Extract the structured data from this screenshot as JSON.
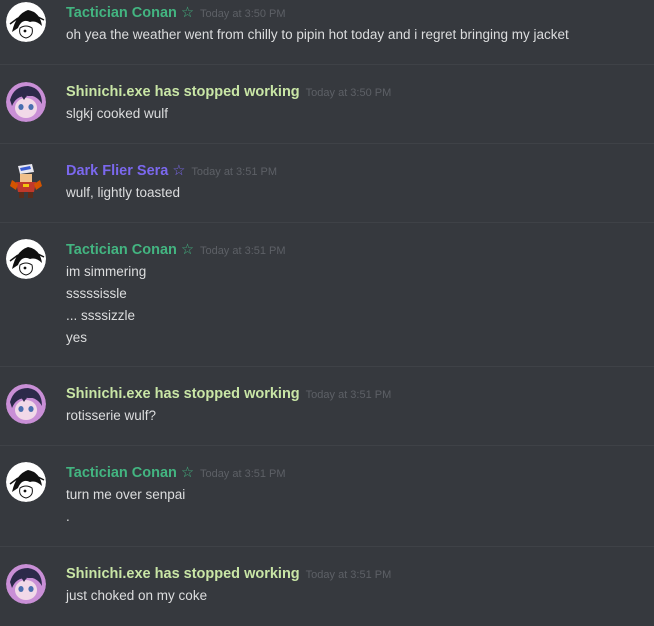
{
  "colors": {
    "background": "#36393e",
    "divider": "#3f4247",
    "message_text": "#dcddde",
    "timestamp": "#5d6066",
    "user_green": "#43b581",
    "user_lime": "#c9e6a6",
    "user_purple": "#7b68ee"
  },
  "messages": [
    {
      "author": "Tactician Conan ☆",
      "author_color": "green",
      "avatar": "conan-avatar",
      "timestamp": "Today at 3:50 PM",
      "lines": [
        "oh yea the weather went from chilly to pipin hot today and i regret bringing my jacket"
      ]
    },
    {
      "author": "Shinichi.exe has stopped working",
      "author_color": "lime",
      "avatar": "shinichi-avatar",
      "timestamp": "Today at 3:50 PM",
      "lines": [
        "slgkj cooked wulf"
      ]
    },
    {
      "author": "Dark Flier Sera ☆",
      "author_color": "purple",
      "avatar": "sera-avatar",
      "timestamp": "Today at 3:51 PM",
      "lines": [
        "wulf, lightly toasted"
      ]
    },
    {
      "author": "Tactician Conan ☆",
      "author_color": "green",
      "avatar": "conan-avatar",
      "timestamp": "Today at 3:51 PM",
      "lines": [
        "im simmering",
        "sssssissle",
        "... ssssizzle",
        "yes"
      ]
    },
    {
      "author": "Shinichi.exe has stopped working",
      "author_color": "lime",
      "avatar": "shinichi-avatar",
      "timestamp": "Today at 3:51 PM",
      "lines": [
        "rotisserie wulf?"
      ]
    },
    {
      "author": "Tactician Conan ☆",
      "author_color": "green",
      "avatar": "conan-avatar",
      "timestamp": "Today at 3:51 PM",
      "lines": [
        "turn me over senpai",
        "."
      ]
    },
    {
      "author": "Shinichi.exe has stopped working",
      "author_color": "lime",
      "avatar": "shinichi-avatar",
      "timestamp": "Today at 3:51 PM",
      "lines": [
        "just choked on my coke"
      ]
    }
  ]
}
